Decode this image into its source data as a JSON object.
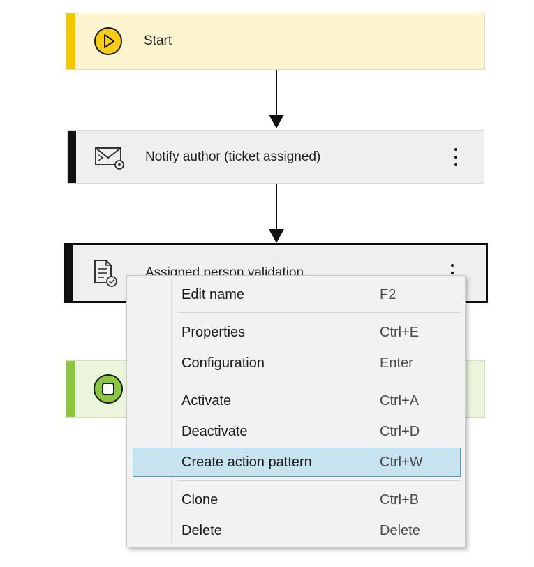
{
  "workflow": {
    "nodes": {
      "start": {
        "label": "Start",
        "icon": "play-icon"
      },
      "notify": {
        "label": "Notify author (ticket assigned)",
        "icon": "mail-settings-icon"
      },
      "validation": {
        "label": "Assigned person validation",
        "icon": "document-check-icon"
      },
      "end": {
        "label": "",
        "icon": "stop-icon"
      }
    }
  },
  "context_menu": {
    "items": [
      {
        "label": "Edit name",
        "shortcut": "F2"
      },
      {
        "label": "Properties",
        "shortcut": "Ctrl+E"
      },
      {
        "label": "Configuration",
        "shortcut": "Enter"
      },
      {
        "label": "Activate",
        "shortcut": "Ctrl+A"
      },
      {
        "label": "Deactivate",
        "shortcut": "Ctrl+D"
      },
      {
        "label": "Create action pattern",
        "shortcut": "Ctrl+W",
        "highlighted": true
      },
      {
        "label": "Clone",
        "shortcut": "Ctrl+B"
      },
      {
        "label": "Delete",
        "shortcut": "Delete"
      }
    ]
  },
  "colors": {
    "start_accent": "#f4c800",
    "end_accent": "#8cc63f",
    "highlight": "#c7e3ef",
    "highlight_border": "#41a0d1"
  }
}
